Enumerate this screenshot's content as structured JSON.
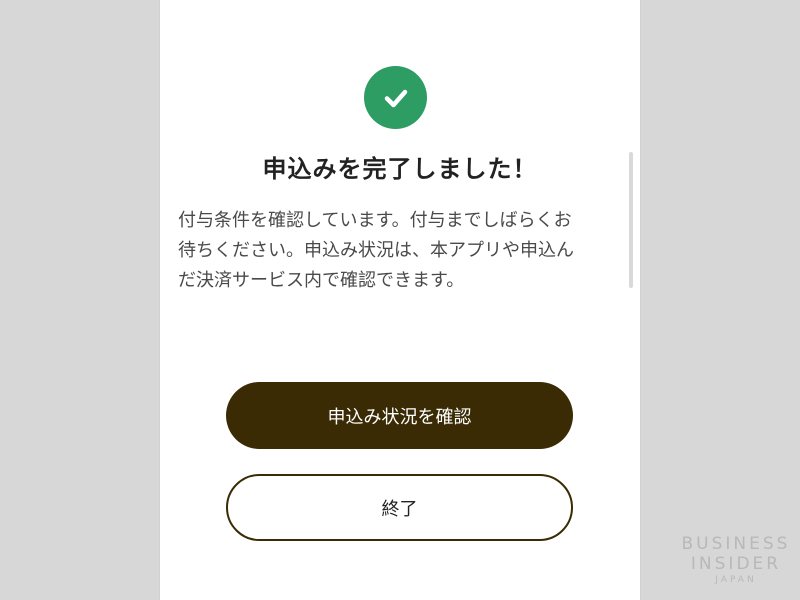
{
  "colors": {
    "page_background": "#d7d7d7",
    "card_background": "#ffffff",
    "success_green": "#2e9d63",
    "primary_button": "#3a2b05",
    "title_text": "#222222",
    "body_text": "#4a4a4a"
  },
  "status_icon": "check-circle-icon",
  "title": "申込みを完了しました！",
  "message_lines": [
    "付与条件を確認しています。付与までしばらくお",
    "待ちください。申込み状況は、本アプリや申込ん",
    "だ決済サービス内で確認できます。"
  ],
  "buttons": {
    "check_status": "申込み状況を確認",
    "finish": "終了"
  },
  "watermark": {
    "line1": "BUSINESS",
    "line2": "INSIDER",
    "line3": "JAPAN"
  }
}
